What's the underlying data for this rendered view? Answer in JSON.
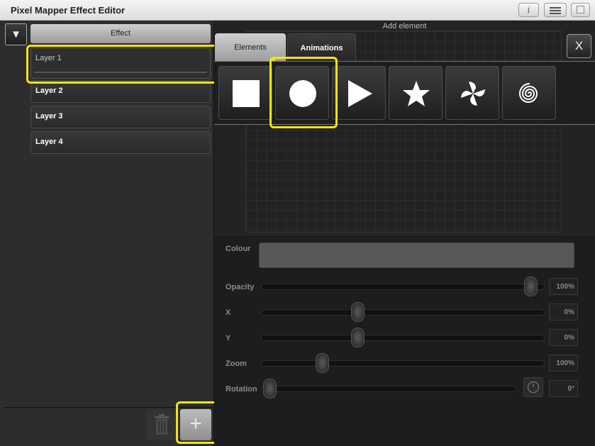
{
  "window": {
    "title": "Pixel Mapper Effect Editor",
    "info_glyph": "i"
  },
  "left": {
    "collapse_glyph": "▼",
    "effect_header": "Effect",
    "layers": [
      "Layer 1",
      "Layer 2",
      "Layer 3",
      "Layer 4"
    ],
    "add_glyph": "+"
  },
  "right": {
    "add_element_label": "Add element",
    "tabs": {
      "elements": "Elements",
      "animations": "Animations"
    },
    "close_glyph": "X",
    "shapes": [
      "square-shape-icon",
      "circle-shape-icon",
      "triangle-shape-icon",
      "star-shape-icon",
      "pinwheel-shape-icon",
      "spiral-shape-icon"
    ],
    "properties": {
      "colour": {
        "label": "Colour",
        "value_color": "#585858"
      },
      "opacity": {
        "label": "Opacity",
        "value": "100%",
        "level": 1.0
      },
      "x": {
        "label": "X",
        "value": "0%",
        "level": 0.5
      },
      "y": {
        "label": "Y",
        "value": "0%",
        "level": 0.5
      },
      "zoom": {
        "label": "Zoom",
        "value": "100%",
        "level": 0.22
      },
      "rotation": {
        "label": "Rotation",
        "value": "0°",
        "level": 0.0
      }
    }
  },
  "colors": {
    "highlight": "#f2e410"
  }
}
